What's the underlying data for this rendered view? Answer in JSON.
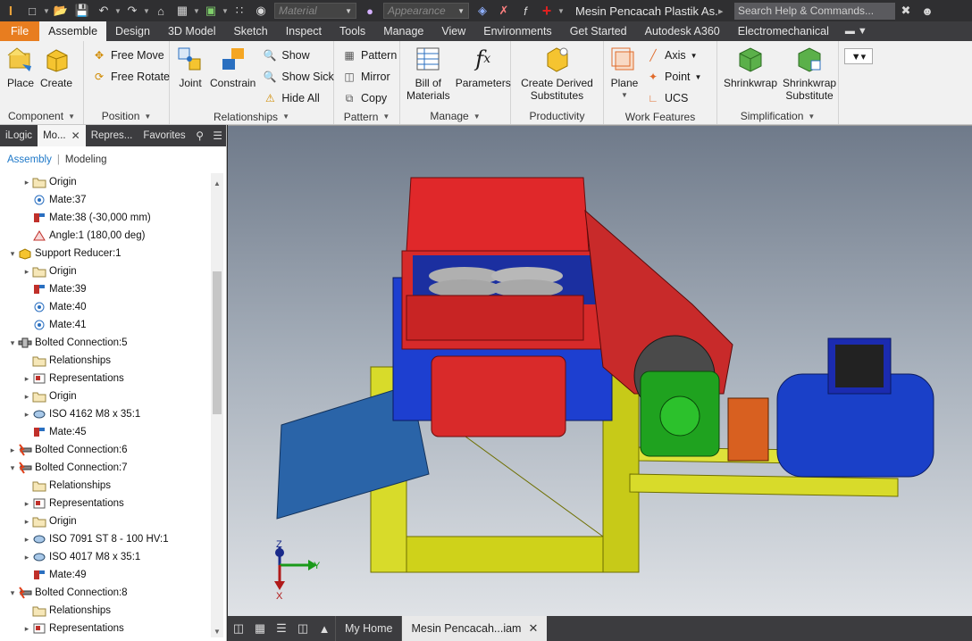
{
  "app": {
    "logo": "I",
    "doc_title": "Mesin Pencacah Plastik As...",
    "search_placeholder": "Search Help & Commands...",
    "material_placeholder": "Material",
    "appearance_placeholder": "Appearance"
  },
  "tabs": [
    "File",
    "Assemble",
    "Design",
    "3D Model",
    "Sketch",
    "Inspect",
    "Tools",
    "Manage",
    "View",
    "Environments",
    "Get Started",
    "Autodesk A360",
    "Electromechanical"
  ],
  "active_tab": "Assemble",
  "ribbon": {
    "component": {
      "title": "Component",
      "place": "Place",
      "create": "Create"
    },
    "position": {
      "title": "Position",
      "free_move": "Free Move",
      "free_rotate": "Free Rotate"
    },
    "relationships": {
      "title": "Relationships",
      "joint": "Joint",
      "constrain": "Constrain",
      "show": "Show",
      "show_sick": "Show Sick",
      "hide_all": "Hide All"
    },
    "pattern": {
      "title": "Pattern",
      "pattern": "Pattern",
      "mirror": "Mirror",
      "copy": "Copy"
    },
    "manage": {
      "title": "Manage",
      "bom_line1": "Bill of",
      "bom_line2": "Materials",
      "parameters": "Parameters"
    },
    "productivity": {
      "title": "Productivity",
      "cds_line1": "Create Derived",
      "cds_line2": "Substitutes"
    },
    "work_features": {
      "title": "Work Features",
      "plane": "Plane",
      "axis": "Axis",
      "point": "Point",
      "ucs": "UCS"
    },
    "simplification": {
      "title": "Simplification",
      "shrinkwrap": "Shrinkwrap",
      "sws_line1": "Shrinkwrap",
      "sws_line2": "Substitute"
    }
  },
  "browser": {
    "tabs": [
      "iLogic",
      "Mo...",
      "Repres...",
      "Favorites"
    ],
    "mode_assembly": "Assembly",
    "mode_modeling": "Modeling",
    "tree": [
      {
        "label": "Origin",
        "icon": "folder-icon",
        "indent": 1,
        "expander": "right"
      },
      {
        "label": "Mate:37",
        "icon": "mate-icon",
        "indent": 1,
        "expander": ""
      },
      {
        "label": "Mate:38 (-30,000 mm)",
        "icon": "flush-icon",
        "indent": 1,
        "expander": ""
      },
      {
        "label": "Angle:1 (180,00 deg)",
        "icon": "angle-icon",
        "indent": 1,
        "expander": ""
      },
      {
        "label": "Support Reducer:1",
        "icon": "part-icon",
        "indent": 0,
        "expander": "down"
      },
      {
        "label": "Origin",
        "icon": "folder-icon",
        "indent": 1,
        "expander": "right"
      },
      {
        "label": "Mate:39",
        "icon": "flush-icon",
        "indent": 1,
        "expander": ""
      },
      {
        "label": "Mate:40",
        "icon": "mate-icon",
        "indent": 1,
        "expander": ""
      },
      {
        "label": "Mate:41",
        "icon": "mate-icon",
        "indent": 1,
        "expander": ""
      },
      {
        "label": "Bolted Connection:5",
        "icon": "bolt-icon",
        "indent": 0,
        "expander": "down"
      },
      {
        "label": "Relationships",
        "icon": "folder-icon",
        "indent": 1,
        "expander": ""
      },
      {
        "label": "Representations",
        "icon": "representations-icon",
        "indent": 1,
        "expander": "right"
      },
      {
        "label": "Origin",
        "icon": "folder-icon",
        "indent": 1,
        "expander": "right"
      },
      {
        "label": "ISO 4162 M8 x 35:1",
        "icon": "fastener-icon",
        "indent": 1,
        "expander": "right"
      },
      {
        "label": "Mate:45",
        "icon": "flush-icon",
        "indent": 1,
        "expander": ""
      },
      {
        "label": "Bolted Connection:6",
        "icon": "bolt-error-icon",
        "indent": 0,
        "expander": "right"
      },
      {
        "label": "Bolted Connection:7",
        "icon": "bolt-error-icon",
        "indent": 0,
        "expander": "down"
      },
      {
        "label": "Relationships",
        "icon": "folder-icon",
        "indent": 1,
        "expander": ""
      },
      {
        "label": "Representations",
        "icon": "representations-icon",
        "indent": 1,
        "expander": "right"
      },
      {
        "label": "Origin",
        "icon": "folder-icon",
        "indent": 1,
        "expander": "right"
      },
      {
        "label": "ISO 7091 ST 8 - 100 HV:1",
        "icon": "fastener-icon",
        "indent": 1,
        "expander": "right"
      },
      {
        "label": "ISO 4017 M8 x 35:1",
        "icon": "fastener-icon",
        "indent": 1,
        "expander": "right"
      },
      {
        "label": "Mate:49",
        "icon": "flush-icon",
        "indent": 1,
        "expander": ""
      },
      {
        "label": "Bolted Connection:8",
        "icon": "bolt-error-icon",
        "indent": 0,
        "expander": "down"
      },
      {
        "label": "Relationships",
        "icon": "folder-icon",
        "indent": 1,
        "expander": ""
      },
      {
        "label": "Representations",
        "icon": "representations-icon",
        "indent": 1,
        "expander": "right"
      }
    ]
  },
  "viewport": {
    "axis_x": "X",
    "axis_y": "Y",
    "axis_z": "Z"
  },
  "doc_tabs": {
    "home": "My Home",
    "active": "Mesin Pencacah...iam"
  },
  "colors": {
    "file_tab": "#e87d1f",
    "accent_blue": "#1e78c8",
    "dark_chrome": "#3c3c3f"
  }
}
